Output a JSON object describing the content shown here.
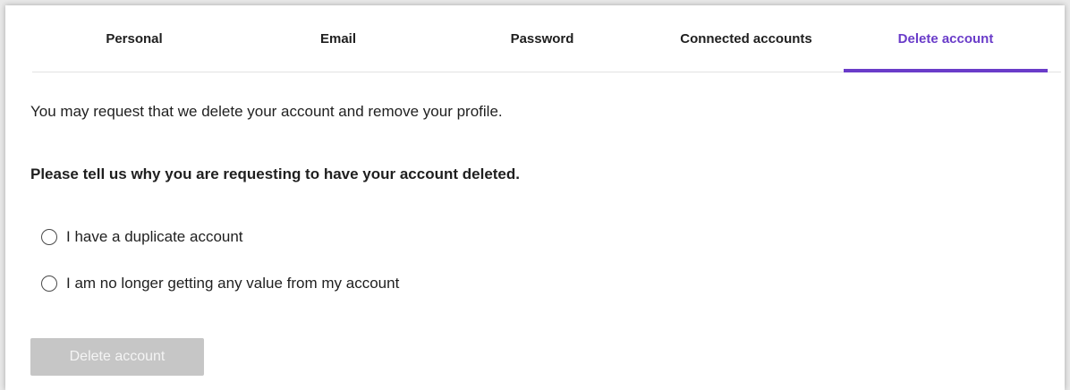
{
  "tabs": [
    {
      "label": "Personal"
    },
    {
      "label": "Email"
    },
    {
      "label": "Password"
    },
    {
      "label": "Connected accounts"
    },
    {
      "label": "Delete account"
    }
  ],
  "active_tab": "Delete account",
  "accent_color": "#6a3cc9",
  "content": {
    "intro": "You may request that we delete your account and remove your profile.",
    "question": "Please tell us why you are requesting to have your account deleted.",
    "options": [
      {
        "label": "I have a duplicate account",
        "selected": false
      },
      {
        "label": "I am no longer getting any value from my account",
        "selected": false
      }
    ],
    "delete_button": {
      "label": "Delete account",
      "disabled": true
    }
  }
}
